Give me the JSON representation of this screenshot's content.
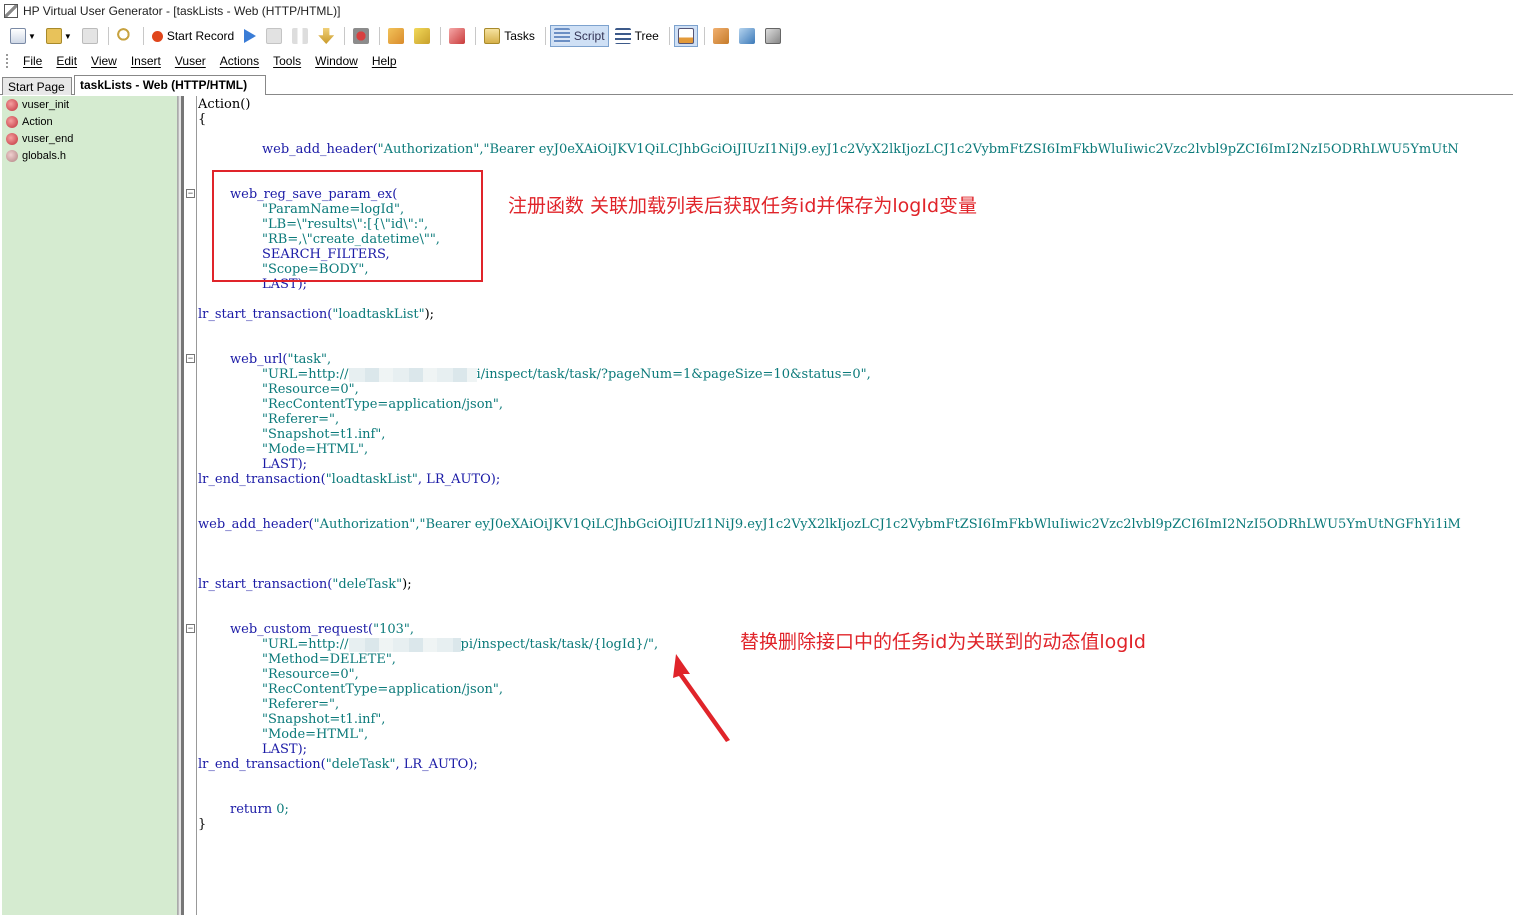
{
  "window": {
    "title": "HP Virtual User Generator - [taskLists - Web (HTTP/HTML)]"
  },
  "toolbar": {
    "start_record": "Start Record",
    "tasks": "Tasks",
    "script": "Script",
    "tree": "Tree"
  },
  "menu": [
    "File",
    "Edit",
    "View",
    "Insert",
    "Vuser",
    "Actions",
    "Tools",
    "Window",
    "Help"
  ],
  "tabs": {
    "start_page": "Start Page",
    "document": "taskLists - Web (HTTP/HTML)"
  },
  "tree": {
    "items": [
      {
        "label": "vuser_init",
        "icon": "script-icon"
      },
      {
        "label": "Action",
        "icon": "script-icon"
      },
      {
        "label": "vuser_end",
        "icon": "script-icon"
      },
      {
        "label": "globals.h",
        "icon": "header-file-icon"
      }
    ]
  },
  "code": {
    "l01": "Action()",
    "l02": "{",
    "l03a": "web_add_header(",
    "l03b": "\"Authorization\",\"Bearer eyJ0eXAiOiJKV1QiLCJhbGciOiJIUzI1NiJ9.eyJ1c2VyX2lkIjozLCJ1c2VybmFtZSI6ImFkbWluIiwic2Vzc2lvbl9pZCI6ImI2NzI5ODRhLWU5YmUtN",
    "l04": "web_reg_save_param_ex(",
    "l05": "\"ParamName=logId\",",
    "l06": "\"LB=\\\"results\\\":[{\\\"id\\\":\",",
    "l07": "\"RB=,\\\"create_datetime\\\"\",",
    "l08": "SEARCH_FILTERS,",
    "l09": "\"Scope=BODY\",",
    "l10": "LAST);",
    "l11a": "lr_start_transaction(",
    "l11b": "\"loadtaskList\"",
    "l11c": ");",
    "l12a": "web_url(",
    "l12b": "\"task\",",
    "l13a": "\"URL=http://",
    "l13b": "i/inspect/task/task/?pageNum=1&pageSize=10&status=0\",",
    "l14": "\"Resource=0\",",
    "l15": "\"RecContentType=application/json\",",
    "l16": "\"Referer=\",",
    "l17": "\"Snapshot=t1.inf\",",
    "l18": "\"Mode=HTML\",",
    "l19": "LAST);",
    "l20a": "lr_end_transaction(",
    "l20b": "\"loadtaskList\"",
    "l20c": ", LR_AUTO);",
    "l21a": "web_add_header(",
    "l21b": "\"Authorization\",\"Bearer eyJ0eXAiOiJKV1QiLCJhbGciOiJIUzI1NiJ9.eyJ1c2VyX2lkIjozLCJ1c2VybmFtZSI6ImFkbWluIiwic2Vzc2lvbl9pZCI6ImI2NzI5ODRhLWU5YmUtNGFhYi1iM",
    "l22a": "lr_start_transaction(",
    "l22b": "\"deleTask\"",
    "l22c": ");",
    "l23a": "web_custom_request(",
    "l23b": "\"103\",",
    "l24a": "\"URL=http://",
    "l24b": "pi/inspect/task/task/{logId}/\",",
    "l25": "\"Method=DELETE\",",
    "l26": "\"Resource=0\",",
    "l27": "\"RecContentType=application/json\",",
    "l28": "\"Referer=\",",
    "l29": "\"Snapshot=t1.inf\",",
    "l30": "\"Mode=HTML\",",
    "l31": "LAST);",
    "l32a": "lr_end_transaction(",
    "l32b": "\"deleTask\"",
    "l32c": ", LR_AUTO);",
    "l33a": "return",
    "l33b": " 0;",
    "l34": "}"
  },
  "annotations": {
    "note1": "注册函数 关联加载列表后获取任务id并保存为logId变量",
    "note2": "替换删除接口中的任务id为关联到的动态值logId",
    "color": "#e0242a"
  }
}
